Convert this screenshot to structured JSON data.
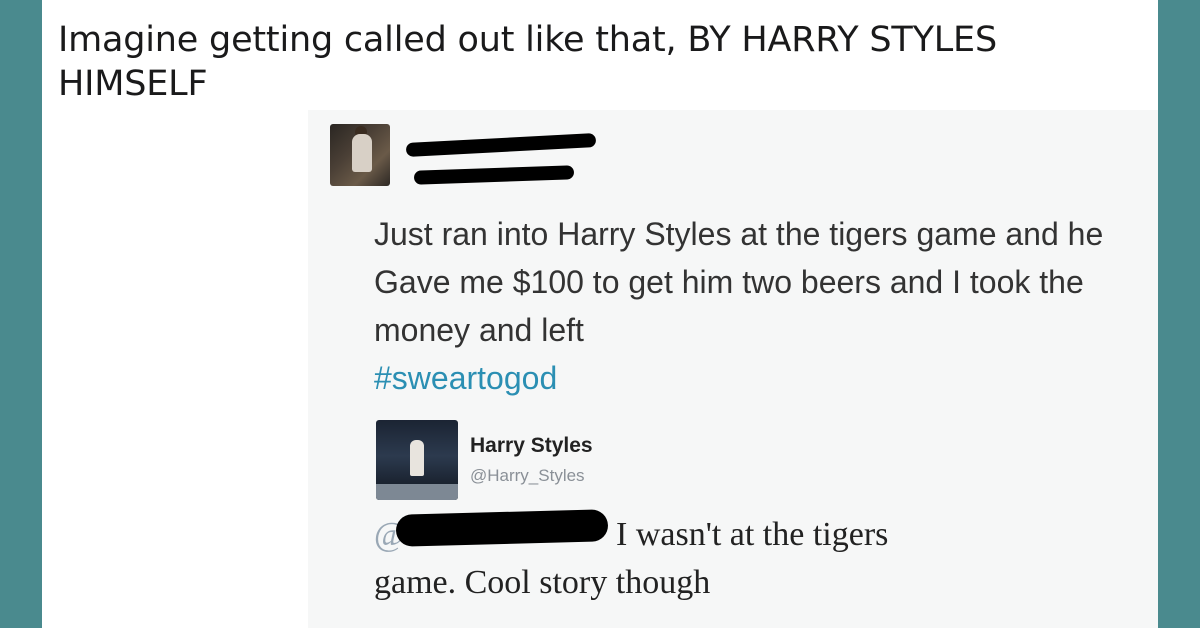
{
  "post": {
    "title": "Imagine getting called out like that, BY HARRY STYLES HIMSELF"
  },
  "tweet": {
    "text": "Just ran into Harry Styles at the tigers game and he Gave me $100 to get him two beers and I took the money and left",
    "hashtag": "#sweartogod"
  },
  "reply": {
    "name": "Harry Styles",
    "handle": "@Harry_Styles",
    "mention_visible": "@",
    "line1": "I wasn't at the tigers",
    "line2": "game. Cool story though"
  },
  "colors": {
    "background": "#4a8a8e",
    "hashtag": "#2b8fb3"
  }
}
